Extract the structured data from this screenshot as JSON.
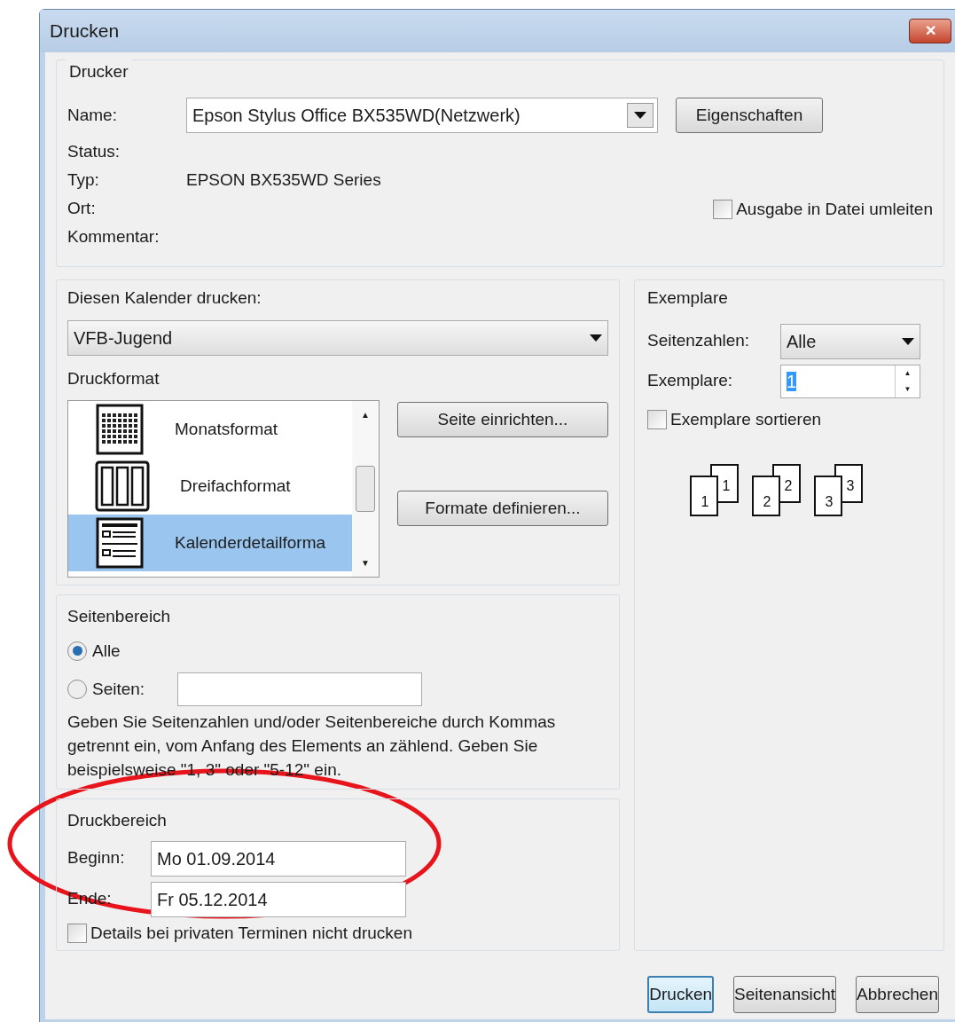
{
  "window": {
    "title": "Drucken",
    "close": "✕"
  },
  "printer": {
    "group": "Drucker",
    "name_label": "Name:",
    "name_value": "Epson Stylus Office BX535WD(Netzwerk)",
    "properties_button": "Eigenschaften",
    "fields": [
      {
        "label": "Status:"
      },
      {
        "label": "Typ:",
        "value": "EPSON BX535WD Series"
      },
      {
        "label": "Ort:"
      },
      {
        "label": "Kommentar:"
      }
    ],
    "print_to_file": {
      "label": "Ausgabe in Datei umleiten",
      "checked": false
    }
  },
  "calendar": {
    "label": "Diesen Kalender drucken:",
    "value": "VFB-Jugend"
  },
  "print_format": {
    "group": "Druckformat",
    "items": [
      {
        "label": "Monatsformat",
        "kind": "month",
        "selected": false
      },
      {
        "label": "Dreifachformat",
        "kind": "tri",
        "selected": false
      },
      {
        "label": "Kalenderdetailforma",
        "kind": "detail",
        "selected": true
      }
    ],
    "scroll_up": "▲",
    "scroll_down": "▼",
    "buttons": [
      "Seite einrichten...",
      "Formate definieren..."
    ]
  },
  "page_range": {
    "group": "Seitenbereich",
    "options": [
      {
        "label": "Alle",
        "selected": true
      },
      {
        "label": "Seiten:",
        "selected": false
      }
    ],
    "hint": "Geben Sie Seitenzahlen und/oder Seitenbereiche durch Kommas getrennt ein, vom Anfang des Elements an zählend. Geben Sie beispielsweise \"1, 3\" oder \"5-12\" ein."
  },
  "print_range": {
    "group": "Druckbereich",
    "start_label": "Beginn:",
    "start": "Mo 01.09.2014",
    "end_label": "Ende:",
    "end": "Fr 05.12.2014",
    "private": {
      "label": "Details bei privaten Terminen nicht drucken",
      "checked": false
    }
  },
  "copies": {
    "group": "Exemplare",
    "pages_label": "Seitenzahlen:",
    "pages_value": "Alle",
    "copies_label": "Exemplare:",
    "copies_value": "1",
    "spin_up": "▲",
    "spin_down": "▼",
    "collate": {
      "label": "Exemplare sortieren",
      "checked": false
    },
    "collate_pages": [
      {
        "back": "1",
        "front": "1"
      },
      {
        "back": "2",
        "front": "2"
      },
      {
        "back": "3",
        "front": "3"
      }
    ]
  },
  "buttons": [
    {
      "label": "Drucken",
      "default": true
    },
    {
      "label": "Seitenansicht",
      "default": false
    },
    {
      "label": "Abbrechen",
      "default": false
    }
  ],
  "annotation": {
    "kind": "ellipse",
    "color": "#e8141c"
  }
}
